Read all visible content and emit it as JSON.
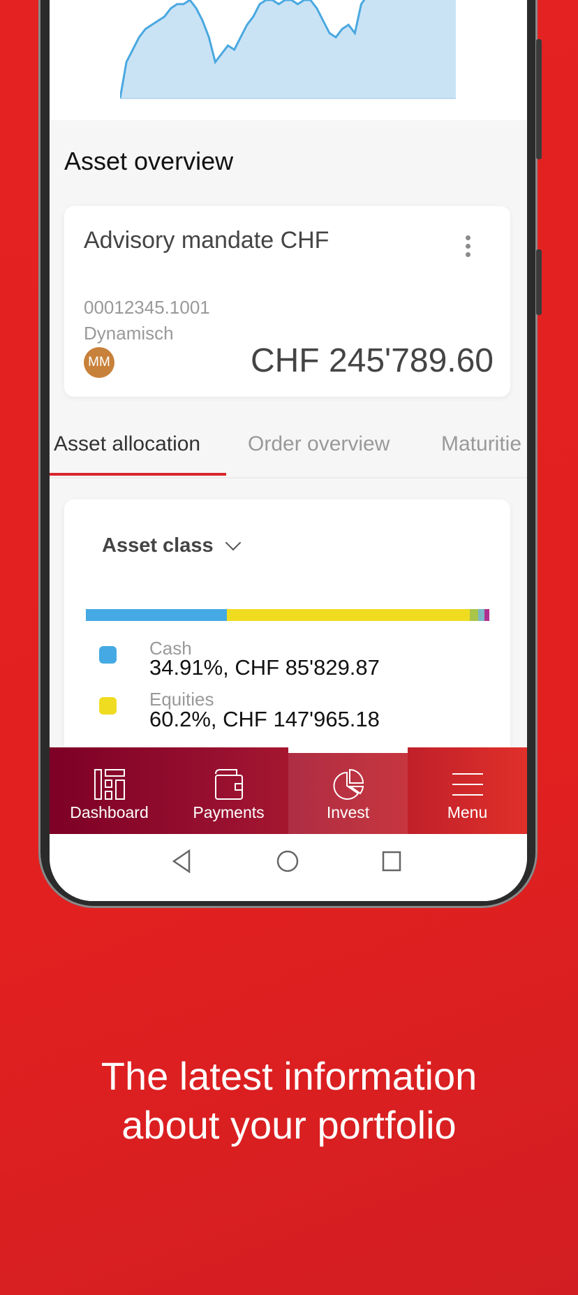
{
  "chart_data": {
    "type": "area",
    "color": "#4aa8e0",
    "fill": "#c9e3f5",
    "values": [
      0,
      44,
      59,
      74,
      84,
      89,
      94,
      99,
      109,
      114,
      114,
      119,
      109,
      94,
      74,
      44,
      54,
      64,
      59,
      74,
      89,
      99,
      114,
      119,
      119,
      114,
      119,
      119,
      114,
      119,
      119,
      109,
      94,
      79,
      74,
      84,
      89,
      79,
      114,
      125,
      130,
      135,
      135,
      135,
      135
    ]
  },
  "overview": {
    "title": "Asset overview",
    "card": {
      "title": "Advisory mandate CHF",
      "account": "00012345.1001",
      "strategy": "Dynamisch",
      "avatar": "MM",
      "avatar_color": "#c8813a",
      "amount": "CHF 245'789.60"
    }
  },
  "tabs": [
    {
      "label": "Asset allocation",
      "active": true
    },
    {
      "label": "Order overview"
    },
    {
      "label": "Maturitie"
    }
  ],
  "allocation": {
    "selector": "Asset class",
    "segments": [
      {
        "pct": 34.91,
        "color": "#45a9e3"
      },
      {
        "pct": 60.2,
        "color": "#efdc21"
      },
      {
        "pct": 2.1,
        "color": "#a9c54a"
      },
      {
        "pct": 1.6,
        "color": "#7cb9c6"
      },
      {
        "pct": 1.19,
        "color": "#b0308f"
      }
    ],
    "legend": [
      {
        "name": "Cash",
        "value": "34.91%, CHF 85'829.87",
        "color": "#45a9e3"
      },
      {
        "name": "Equities",
        "value": "60.2%, CHF 147'965.18",
        "color": "#efdc21"
      }
    ]
  },
  "nav": [
    {
      "label": "Dashboard",
      "icon": "dashboard-icon"
    },
    {
      "label": "Payments",
      "icon": "wallet-icon"
    },
    {
      "label": "Invest",
      "icon": "pie-chart-icon",
      "active": true
    },
    {
      "label": "Menu",
      "icon": "hamburger-icon"
    }
  ],
  "headline": [
    "The latest information",
    "about your portfolio"
  ]
}
